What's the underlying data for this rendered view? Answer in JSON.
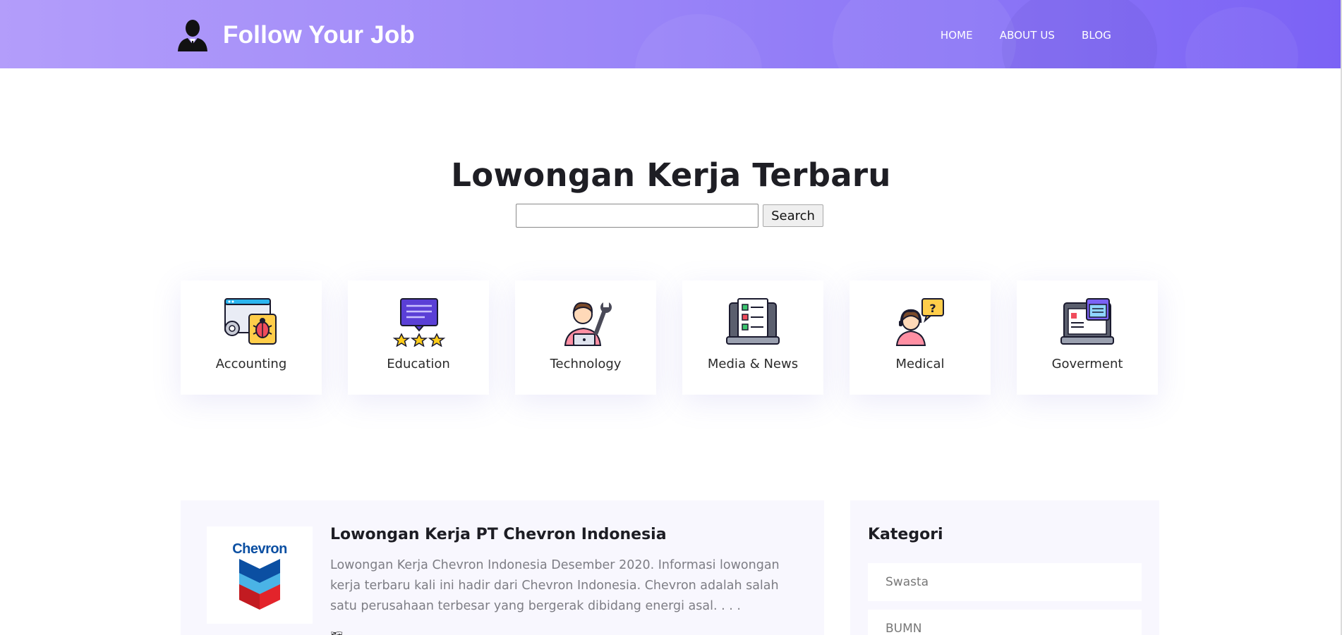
{
  "header": {
    "logo_text": "Follow Your Job",
    "nav": [
      "HOME",
      "ABOUT US",
      "BLOG"
    ],
    "bg_gradient": [
      "#b39dfa",
      "#7b62f5"
    ]
  },
  "hero": {
    "title": "Lowongan Kerja Terbaru",
    "search_placeholder": "",
    "search_button": "Search"
  },
  "categories": [
    {
      "label": "Accounting",
      "icon": "bug-report-icon"
    },
    {
      "label": "Education",
      "icon": "rating-chat-icon"
    },
    {
      "label": "Technology",
      "icon": "engineer-laptop-icon"
    },
    {
      "label": "Media & News",
      "icon": "checklist-laptop-icon"
    },
    {
      "label": "Medical",
      "icon": "support-agent-icon"
    },
    {
      "label": "Goverment",
      "icon": "laptop-dashboard-icon"
    }
  ],
  "job": {
    "logo_word": "Chevron",
    "title": "Lowongan Kerja PT Chevron Indonesia",
    "description": "Lowongan Kerja Chevron Indonesia Desember 2020. Informasi lowongan kerja terbaru kali ini hadir dari Chevron Indonesia. Chevron adalah salah satu perusahaan terbesar yang bergerak dibidang energi asal. . . ."
  },
  "sidebar": {
    "title": "Kategori",
    "items": [
      "Swasta",
      "BUMN"
    ]
  }
}
